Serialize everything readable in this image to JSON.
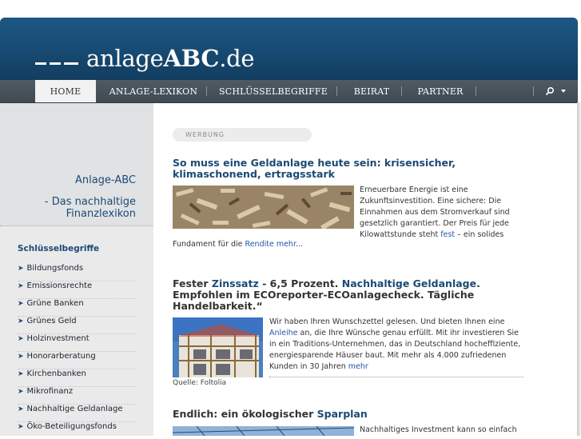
{
  "header": {
    "logo_light": "anlage",
    "logo_bold": "ABC",
    "logo_tld": ".de"
  },
  "nav": {
    "items": [
      "HOME",
      "ANLAGE-LEXIKON",
      "SCHLÜSSELBEGRIFFE",
      "BEIRAT",
      "PARTNER"
    ],
    "active": "HOME"
  },
  "sidebar": {
    "title1": "Anlage-ABC",
    "title2a": "- Das nachhaltige",
    "title2b": "Finanzlexikon",
    "section_heading": "Schlüsselbegriffe",
    "items": [
      "Bildungsfonds",
      "Emissionsrechte",
      "Grüne Banken",
      "Grünes Geld",
      "Holzinvestment",
      "Honorarberatung",
      "Kirchenbanken",
      "Mikrofinanz",
      "Nachhaltige Geldanlage",
      "Öko-Beteiligungsfonds"
    ]
  },
  "main": {
    "ad_label": "WERBUNG",
    "article1": {
      "title_line1": "So muss eine Geldanlage heute sein: krisensicher,",
      "title_line2": "klimaschonend, ertragsstark",
      "text_l1": "Erneuerbare Energie ist eine",
      "text_l2": "Zukunftsinvestition. Eine sichere: Die",
      "text_l3": "Einnahmen aus dem Stromverkauf sind",
      "text_l4": "gesetzlich garantiert. Der Preis für jede",
      "text_l5a": "Kilowattstunde steht ",
      "text_l5_link": "fest",
      "text_l5b": " – ein solides",
      "cont_a": "Fundament für die ",
      "cont_link": "Rendite",
      "cont_more": " mehr..."
    },
    "article2": {
      "t1a": "Fester ",
      "t1_kw1": "Zinssatz",
      "t1b": " - 6,5 Prozent. ",
      "t1_kw2": "Nachhaltige Geldanlage",
      "t1c": ".",
      "t2": "Empfohlen im ECOreporter-ECOanlagecheck. Tägliche",
      "t3": "Handelbarkeit.“",
      "l1": "Wir haben Ihren Wunschzettel gelesen. Und bieten Ihnen eine",
      "l2_link": "Anleihe",
      "l2b": " an, die Ihre Wünsche genau erfüllt. Mit ihr investieren Sie",
      "l3": "in ein Traditions-Unternehmen, das in Deutschland hocheffiziente,",
      "l4": "energiesparende Häuser baut. Mit mehr als 4.000 zufriedenen",
      "l5": "Kunden in 30 Jahren ",
      "l5_more": "mehr",
      "caption": "Quelle: Foltolia"
    },
    "article3": {
      "title_a": "Endlich: ein ökologischer ",
      "title_kw": "Sparplan",
      "text_l1": "Nachhaltiges Investment kann so einfach"
    }
  },
  "colors": {
    "header_blue": "#1a5180",
    "nav_gray": "#4a555d",
    "title_blue": "#1b4a74",
    "link_blue": "#2255aa"
  }
}
